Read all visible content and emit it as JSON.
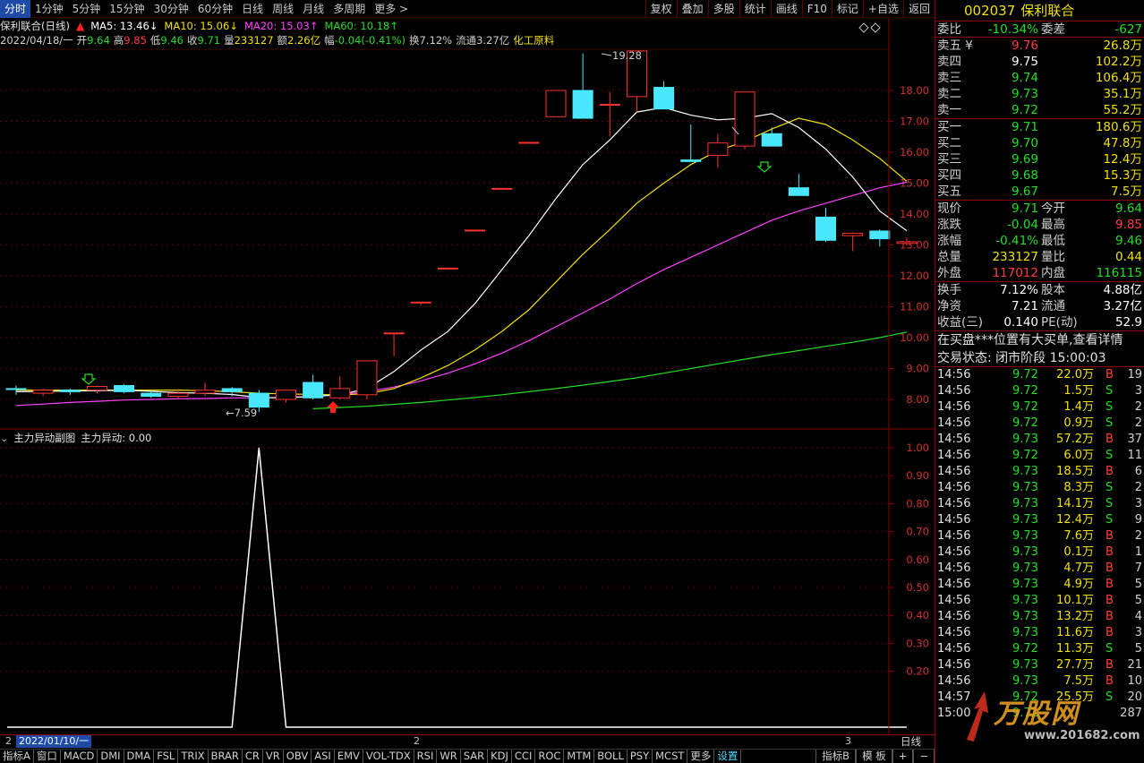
{
  "period_tabs": [
    "分时",
    "1分钟",
    "5分钟",
    "15分钟",
    "30分钟",
    "60分钟",
    "日线",
    "周线",
    "月线",
    "多周期",
    "更多 >"
  ],
  "active_period": "分时",
  "tool_buttons": [
    "复权",
    "叠加",
    "多股",
    "统计",
    "画线",
    "F10",
    "标记",
    "+自选",
    "返回"
  ],
  "legend": {
    "title": "保利联合(日线)",
    "ma5": "MA5: 13.46↓",
    "ma10": "MA10: 15.06↓",
    "ma20": "MA20: 15.03↑",
    "ma60": "MA60: 10.18↑",
    "colors": {
      "ma5": "#ffffff",
      "ma10": "#f0e000",
      "ma20": "#ff40ff",
      "ma60": "#22dd22"
    }
  },
  "info": {
    "date": "2022/04/18/一",
    "open_label": "开",
    "open": "9.64",
    "high_label": "高",
    "high": "9.85",
    "low_label": "低",
    "low": "9.46",
    "close_label": "收",
    "close": "9.71",
    "vol_label": "量",
    "vol": "233127",
    "amt_label": "额",
    "amt": "2.26亿",
    "range_label": "幅",
    "range": "-0.04(-0.41%)",
    "turnover_label": "换",
    "turnover": "7.12%",
    "float_label": "流通",
    "float": "3.27亿",
    "industry": "化工原料"
  },
  "price_axis": [
    "18.00",
    "17.00",
    "16.00",
    "15.00",
    "14.00",
    "13.00",
    "12.00",
    "11.00",
    "10.00",
    "9.00",
    "8.00"
  ],
  "high_mark": "19.28",
  "low_mark": "7.59",
  "sub_chart": {
    "title": "主力异动副图",
    "value_label": "主力异动: 0.00",
    "axis": [
      "1.00",
      "0.90",
      "0.80",
      "0.70",
      "0.60",
      "0.50",
      "0.40",
      "0.30",
      "0.20"
    ]
  },
  "chart_data": {
    "type": "candlestick",
    "price_range": [
      7.6,
      19.3
    ],
    "candles": [
      {
        "o": 8.35,
        "c": 8.32,
        "h": 8.45,
        "l": 8.15
      },
      {
        "o": 8.2,
        "c": 8.3,
        "h": 8.35,
        "l": 8.1
      },
      {
        "o": 8.3,
        "c": 8.25,
        "h": 8.35,
        "l": 8.15
      },
      {
        "o": 8.3,
        "c": 8.42,
        "h": 8.45,
        "l": 8.2
      },
      {
        "o": 8.45,
        "c": 8.25,
        "h": 8.5,
        "l": 8.2
      },
      {
        "o": 8.2,
        "c": 8.1,
        "h": 8.3,
        "l": 8.05
      },
      {
        "o": 8.1,
        "c": 8.2,
        "h": 8.35,
        "l": 8.0
      },
      {
        "o": 8.2,
        "c": 8.3,
        "h": 8.55,
        "l": 8.1
      },
      {
        "o": 8.35,
        "c": 8.25,
        "h": 8.4,
        "l": 8.1
      },
      {
        "o": 8.2,
        "c": 7.75,
        "h": 8.3,
        "l": 7.59
      },
      {
        "o": 8.0,
        "c": 8.3,
        "h": 8.3,
        "l": 7.9
      },
      {
        "o": 8.55,
        "c": 8.05,
        "h": 8.8,
        "l": 8.0
      },
      {
        "o": 8.05,
        "c": 8.35,
        "h": 8.75,
        "l": 8.0
      },
      {
        "o": 8.15,
        "c": 9.25,
        "h": 9.25,
        "l": 8.0
      },
      {
        "o": 10.15,
        "c": 10.15,
        "h": 10.15,
        "l": 9.4
      },
      {
        "o": 11.15,
        "c": 11.15,
        "h": 11.15,
        "l": 11.05
      },
      {
        "o": 12.25,
        "c": 12.25,
        "h": 12.25,
        "l": 12.25
      },
      {
        "o": 13.48,
        "c": 13.48,
        "h": 13.48,
        "l": 13.48
      },
      {
        "o": 14.83,
        "c": 14.83,
        "h": 14.83,
        "l": 14.83
      },
      {
        "o": 16.32,
        "c": 16.32,
        "h": 16.32,
        "l": 16.32
      },
      {
        "o": 17.15,
        "c": 18.0,
        "h": 18.0,
        "l": 17.15
      },
      {
        "o": 18.0,
        "c": 17.1,
        "h": 19.2,
        "l": 17.1
      },
      {
        "o": 17.55,
        "c": 17.55,
        "h": 17.95,
        "l": 16.5
      },
      {
        "o": 17.8,
        "c": 19.28,
        "h": 19.28,
        "l": 17.3
      },
      {
        "o": 18.1,
        "c": 17.4,
        "h": 18.3,
        "l": 17.4
      },
      {
        "o": 15.75,
        "c": 15.7,
        "h": 16.9,
        "l": 15.7
      },
      {
        "o": 15.9,
        "c": 16.3,
        "h": 16.6,
        "l": 15.5
      },
      {
        "o": 16.2,
        "c": 17.95,
        "h": 17.95,
        "l": 16.1
      },
      {
        "o": 16.6,
        "c": 16.2,
        "h": 16.8,
        "l": 16.2
      },
      {
        "o": 14.85,
        "c": 14.6,
        "h": 15.3,
        "l": 14.6
      },
      {
        "o": 13.9,
        "c": 13.15,
        "h": 14.2,
        "l": 13.1
      },
      {
        "o": 13.3,
        "c": 13.38,
        "h": 13.4,
        "l": 12.8
      },
      {
        "o": 13.45,
        "c": 13.2,
        "h": 13.5,
        "l": 12.95
      },
      {
        "o": 13.05,
        "c": 13.1,
        "h": 13.25,
        "l": 12.98
      }
    ],
    "ma5": [
      8.25,
      8.26,
      8.27,
      8.28,
      8.3,
      8.26,
      8.22,
      8.2,
      8.16,
      8.06,
      8.05,
      8.1,
      8.15,
      8.35,
      8.9,
      9.6,
      10.2,
      11.1,
      12.2,
      13.3,
      14.5,
      15.6,
      16.4,
      17.3,
      17.45,
      17.2,
      17.05,
      17.1,
      17.25,
      16.8,
      16.1,
      15.2,
      14.1,
      13.46
    ],
    "ma10": [
      8.3,
      8.3,
      8.3,
      8.3,
      8.3,
      8.3,
      8.3,
      8.28,
      8.25,
      8.2,
      8.18,
      8.16,
      8.15,
      8.18,
      8.35,
      8.7,
      9.1,
      9.6,
      10.2,
      10.9,
      11.8,
      12.7,
      13.5,
      14.35,
      15.0,
      15.6,
      16.05,
      16.35,
      16.75,
      17.1,
      16.9,
      16.4,
      15.8,
      15.06
    ],
    "ma20": [
      7.8,
      7.85,
      7.9,
      7.94,
      7.98,
      8.0,
      8.02,
      8.03,
      8.05,
      8.05,
      8.07,
      8.1,
      8.15,
      8.25,
      8.4,
      8.6,
      8.85,
      9.15,
      9.5,
      9.9,
      10.35,
      10.8,
      11.25,
      11.75,
      12.2,
      12.6,
      13.0,
      13.4,
      13.8,
      14.1,
      14.35,
      14.6,
      14.85,
      15.03
    ],
    "ma60": [
      null,
      null,
      null,
      null,
      null,
      null,
      null,
      null,
      null,
      null,
      null,
      7.7,
      7.74,
      7.78,
      7.84,
      7.9,
      7.98,
      8.06,
      8.15,
      8.25,
      8.35,
      8.46,
      8.58,
      8.7,
      8.85,
      9.0,
      9.15,
      9.3,
      9.45,
      9.58,
      9.72,
      9.85,
      10.0,
      10.18
    ],
    "sub_values": [
      0,
      0,
      0,
      0,
      0,
      0,
      0,
      0,
      0,
      1,
      0,
      0,
      0,
      0,
      0,
      0,
      0,
      0,
      0,
      0,
      0,
      0,
      0,
      0,
      0,
      0,
      0,
      0,
      0,
      0,
      0,
      0,
      0,
      0
    ],
    "sub_range": [
      0,
      1
    ]
  },
  "date_row": {
    "box": "2022/01/10/一",
    "day_label": "日线",
    "marker_a": "2",
    "marker_b": "3"
  },
  "indicator_tabs": [
    "指标A",
    "窗口",
    "MACD",
    "DMI",
    "DMA",
    "FSL",
    "TRIX",
    "BRAR",
    "CR",
    "VR",
    "OBV",
    "ASI",
    "EMV",
    "VOL-TDX",
    "RSI",
    "WR",
    "SAR",
    "KDJ",
    "CCI",
    "ROC",
    "MTM",
    "BOLL",
    "PSY",
    "MCST",
    "更多",
    "设置"
  ],
  "active_indicator": "设置",
  "indicator_right": [
    "指标B",
    "模 板",
    "+",
    "−"
  ],
  "quote": {
    "code": "002037",
    "name": "保利联合",
    "weibi_label": "委比",
    "weibi": "-10.34%",
    "weicha_label": "委差",
    "weicha": "-627",
    "asks": [
      {
        "label": "卖五 ¥",
        "price": "9.76",
        "vol": "26.8万"
      },
      {
        "label": "卖四",
        "price": "9.75",
        "vol": "102.2万"
      },
      {
        "label": "卖三",
        "price": "9.74",
        "vol": "106.4万"
      },
      {
        "label": "卖二",
        "price": "9.73",
        "vol": "35.1万"
      },
      {
        "label": "卖一",
        "price": "9.72",
        "vol": "55.2万"
      }
    ],
    "bids": [
      {
        "label": "买一",
        "price": "9.71",
        "vol": "180.6万"
      },
      {
        "label": "买二",
        "price": "9.70",
        "vol": "47.8万"
      },
      {
        "label": "买三",
        "price": "9.69",
        "vol": "12.4万"
      },
      {
        "label": "买四",
        "price": "9.68",
        "vol": "15.3万"
      },
      {
        "label": "买五",
        "price": "9.67",
        "vol": "7.5万"
      }
    ],
    "stats": [
      {
        "l1": "现价",
        "v1": "9.71",
        "c1": "green",
        "l2": "今开",
        "v2": "9.64",
        "c2": "green"
      },
      {
        "l1": "涨跌",
        "v1": "-0.04",
        "c1": "green",
        "l2": "最高",
        "v2": "9.85",
        "c2": "red"
      },
      {
        "l1": "涨幅",
        "v1": "-0.41%",
        "c1": "green",
        "l2": "最低",
        "v2": "9.46",
        "c2": "green"
      },
      {
        "l1": "总量",
        "v1": "233127",
        "c1": "yellow",
        "l2": "量比",
        "v2": "0.44",
        "c2": "yellow"
      },
      {
        "l1": "外盘",
        "v1": "117012",
        "c1": "red",
        "l2": "内盘",
        "v2": "116115",
        "c2": "green"
      }
    ],
    "fundamentals": [
      {
        "l1": "换手",
        "v1": "7.12%",
        "l2": "股本",
        "v2": "4.88亿"
      },
      {
        "l1": "净资",
        "v1": "7.21",
        "l2": "流通",
        "v2": "3.27亿"
      },
      {
        "l1": "收益(三)",
        "v1": "0.140",
        "l2": "PE(动)",
        "v2": "52.9"
      }
    ],
    "notice": "在买盘***位置有大买单,查看详情",
    "trade_state": "交易状态: 闭市阶段 15:00:03"
  },
  "ticks": [
    {
      "t": "14:56",
      "p": "9.72",
      "v": "22.0万",
      "bs": "B",
      "n": "19"
    },
    {
      "t": "14:56",
      "p": "9.72",
      "v": "1.5万",
      "bs": "S",
      "n": "3"
    },
    {
      "t": "14:56",
      "p": "9.72",
      "v": "1.4万",
      "bs": "S",
      "n": "2"
    },
    {
      "t": "14:56",
      "p": "9.72",
      "v": "0.9万",
      "bs": "S",
      "n": "2"
    },
    {
      "t": "14:56",
      "p": "9.73",
      "v": "57.2万",
      "bs": "B",
      "n": "37",
      "vc": "magenta"
    },
    {
      "t": "14:56",
      "p": "9.72",
      "v": "6.0万",
      "bs": "S",
      "n": "11"
    },
    {
      "t": "14:56",
      "p": "9.73",
      "v": "18.5万",
      "bs": "B",
      "n": "6"
    },
    {
      "t": "14:56",
      "p": "9.73",
      "v": "8.3万",
      "bs": "S",
      "n": "2"
    },
    {
      "t": "14:56",
      "p": "9.73",
      "v": "14.1万",
      "bs": "S",
      "n": "3"
    },
    {
      "t": "14:56",
      "p": "9.73",
      "v": "12.4万",
      "bs": "S",
      "n": "9"
    },
    {
      "t": "14:56",
      "p": "9.73",
      "v": "7.6万",
      "bs": "B",
      "n": "2"
    },
    {
      "t": "14:56",
      "p": "9.73",
      "v": "0.1万",
      "bs": "B",
      "n": "1"
    },
    {
      "t": "14:56",
      "p": "9.73",
      "v": "4.7万",
      "bs": "B",
      "n": "7"
    },
    {
      "t": "14:56",
      "p": "9.73",
      "v": "4.9万",
      "bs": "B",
      "n": "5"
    },
    {
      "t": "14:56",
      "p": "9.73",
      "v": "10.1万",
      "bs": "B",
      "n": "5"
    },
    {
      "t": "14:56",
      "p": "9.73",
      "v": "13.2万",
      "bs": "B",
      "n": "4"
    },
    {
      "t": "14:56",
      "p": "9.73",
      "v": "11.6万",
      "bs": "B",
      "n": "3"
    },
    {
      "t": "14:56",
      "p": "9.72",
      "v": "11.3万",
      "bs": "S",
      "n": "5"
    },
    {
      "t": "14:56",
      "p": "9.73",
      "v": "27.7万",
      "bs": "B",
      "n": "21"
    },
    {
      "t": "14:56",
      "p": "9.73",
      "v": "7.5万",
      "bs": "B",
      "n": "10"
    },
    {
      "t": "14:57",
      "p": "9.72",
      "v": "25.5万",
      "bs": "S",
      "n": "20"
    },
    {
      "t": "15:00",
      "p": "9.71",
      "v": "",
      "bs": "",
      "n": "287"
    }
  ],
  "watermark": {
    "text": "万股网",
    "url": "www.201682.com"
  }
}
